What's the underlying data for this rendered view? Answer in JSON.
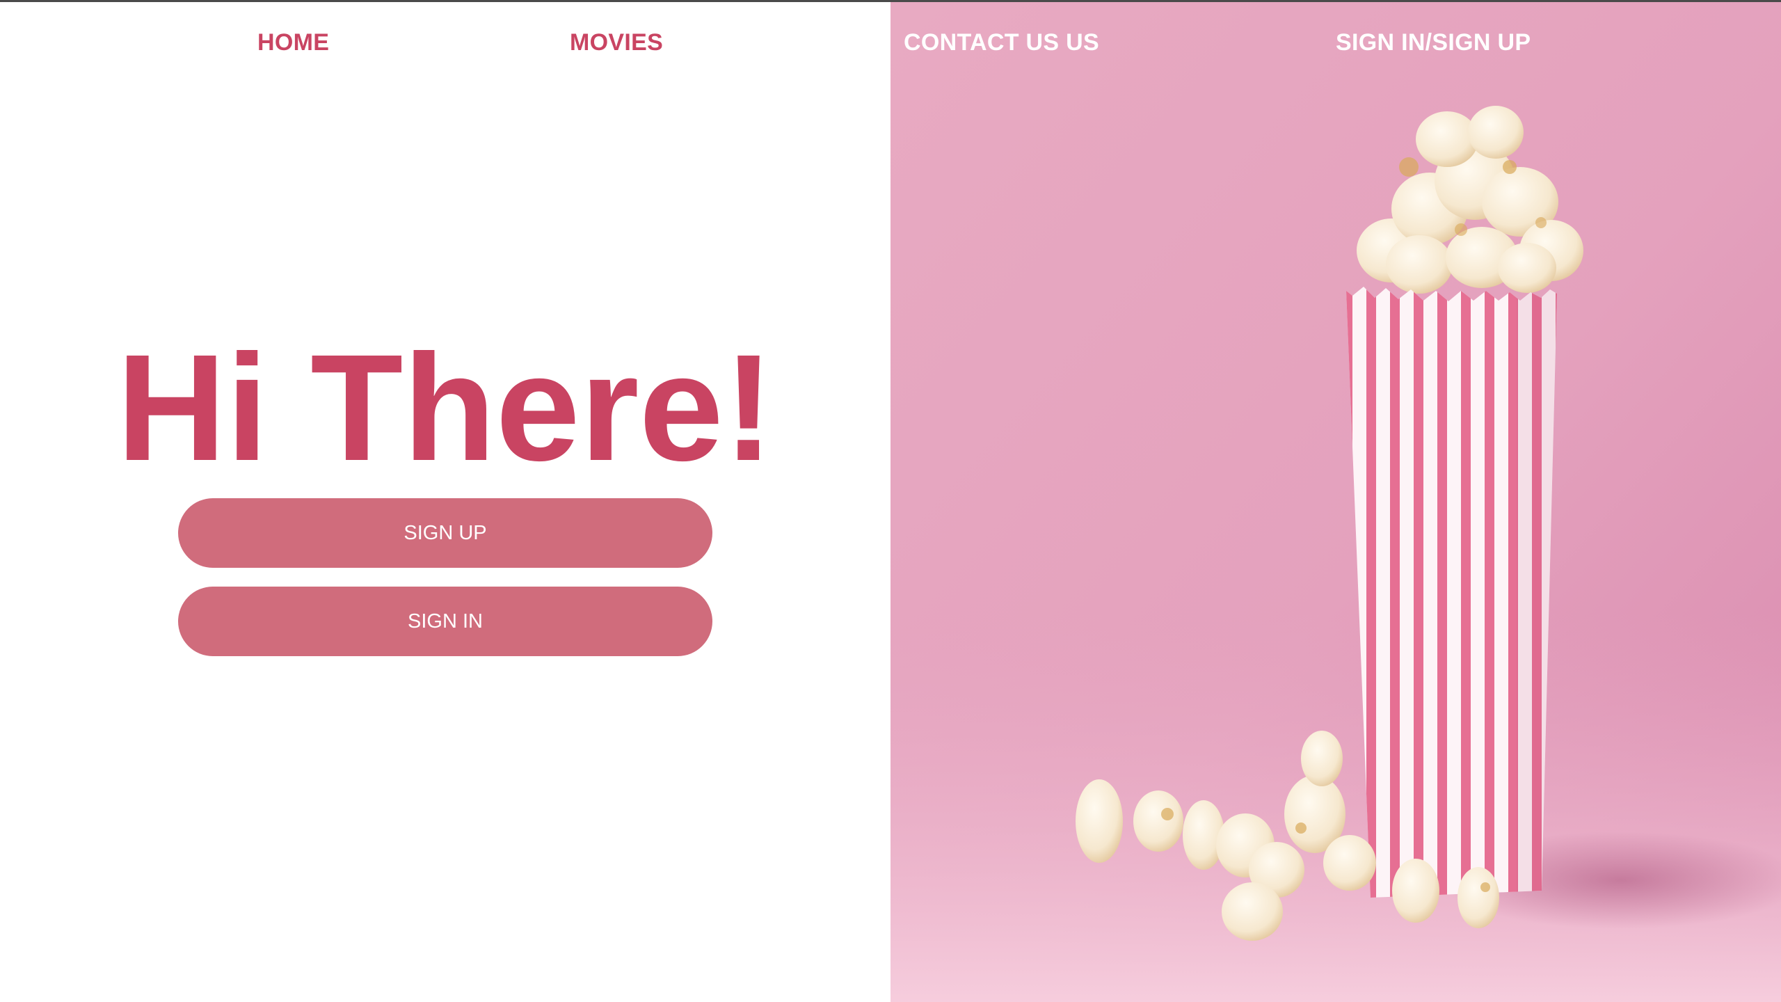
{
  "nav": {
    "home": "HOME",
    "movies": "MOVIES",
    "contact": "CONTACT US US",
    "signin_signup": "SIGN IN/SIGN UP"
  },
  "hero": {
    "title": "Hi There!",
    "signup_label": "SIGN UP",
    "signin_label": "SIGN IN"
  },
  "colors": {
    "brand": "#c94462",
    "button": "#d06c7c",
    "image_bg": "#e6a4bf"
  },
  "image": {
    "subject": "popcorn-bucket-icon"
  }
}
